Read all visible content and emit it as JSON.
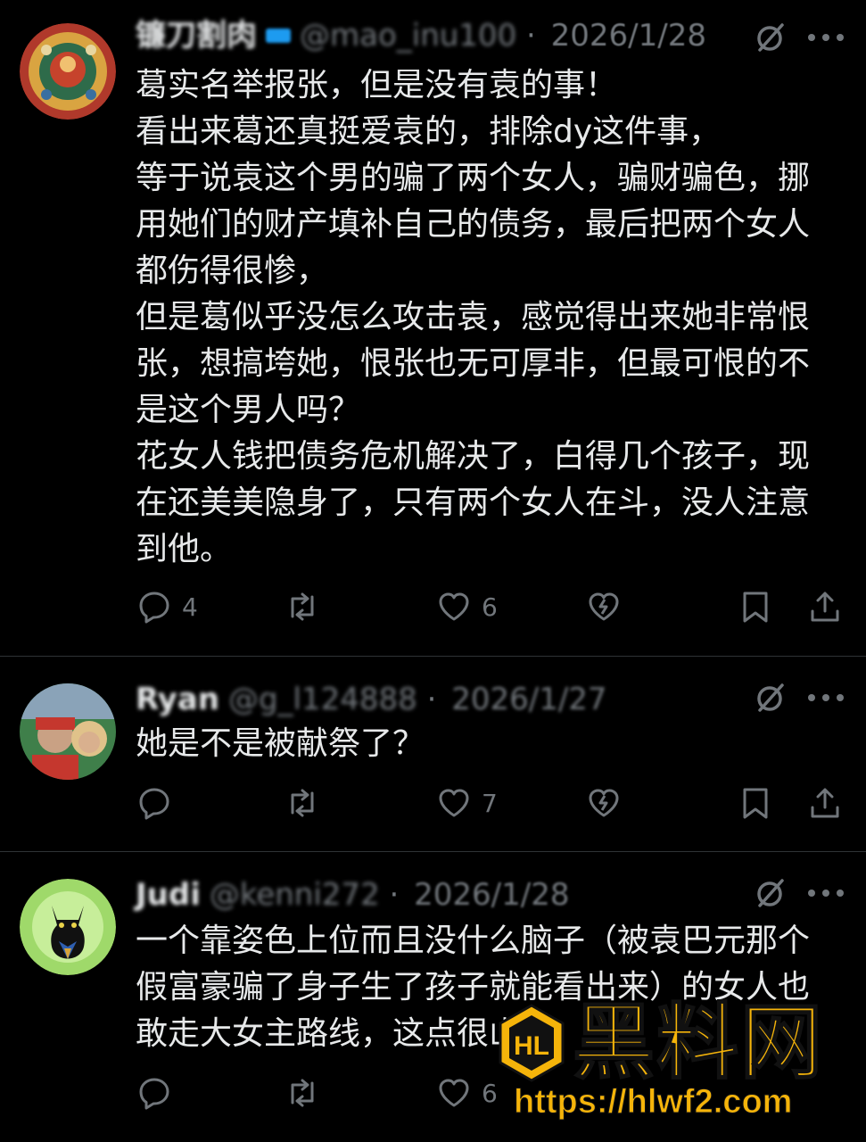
{
  "posts": [
    {
      "name": "镰刀割肉",
      "handle": "@mao_inu100",
      "date": "2026/1/28",
      "body": [
        "葛实名举报张，但是没有袁的事！",
        "看出来葛还真挺爱袁的，排除dy这件事，",
        "等于说袁这个男的骗了两个女人，骗财骗色，挪用她们的财产填补自己的债务，最后把两个女人都伤得很惨，",
        "但是葛似乎没怎么攻击袁，感觉得出来她非常恨张，想搞垮她，恨张也无可厚非，但最可恨的不是这个男人吗？",
        "花女人钱把债务危机解决了，白得几个孩子，现在还美美隐身了，只有两个女人在斗，没人注意到他。"
      ],
      "replies": "4",
      "reposts": "",
      "likes": "6"
    },
    {
      "name": "Ryan",
      "handle": "@g_l124888",
      "date": "2026/1/27",
      "body": [
        "她是不是被献祭了？"
      ],
      "replies": "",
      "reposts": "",
      "likes": "7"
    },
    {
      "name": "Judi",
      "handle": "@kenni272",
      "date": "2026/1/28",
      "body": [
        "一个靠姿色上位而且没什么脑子（被袁巴元那个假富豪骗了身子生了孩子就能看出来）的女人也敢走大女主路线，这点很山东。"
      ],
      "replies": "",
      "reposts": "",
      "likes": "6"
    }
  ],
  "icons": {
    "reply": "reply-icon",
    "repost": "repost-icon",
    "like": "like-icon",
    "grok": "grok-icon",
    "more": "more-icon",
    "bookmark": "bookmark-icon",
    "share": "share-icon",
    "broken_heart": "broken-heart-icon"
  },
  "watermark": {
    "title": "黑料网",
    "logo_text": "HL",
    "url": "https://hlwf2.com"
  },
  "colors": {
    "background": "#000000",
    "text": "#e7e9ea",
    "muted": "#71767b",
    "verified": "#1d9bf0",
    "watermark": "#f5b40a"
  }
}
